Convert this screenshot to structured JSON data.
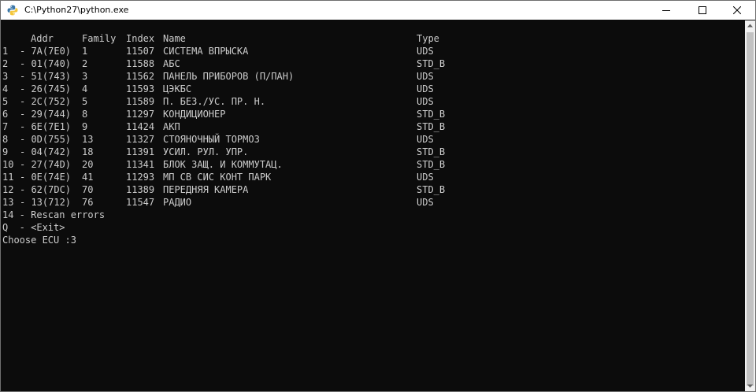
{
  "window": {
    "title": "C:\\Python27\\python.exe"
  },
  "console": {
    "header": {
      "addr": "Addr",
      "family": "Family",
      "index": "Index",
      "name": "Name",
      "type": "Type"
    },
    "rows": [
      {
        "num": "1",
        "addr": "- 7A(7E0)",
        "family": "1",
        "index": "11507",
        "name": "СИСТЕМА ВПРЫСКА",
        "type": "UDS"
      },
      {
        "num": "2",
        "addr": "- 01(740)",
        "family": "2",
        "index": "11588",
        "name": "АБС",
        "type": "STD_B"
      },
      {
        "num": "3",
        "addr": "- 51(743)",
        "family": "3",
        "index": "11562",
        "name": "ПАНЕЛЬ ПРИБОРОВ (П/ПАН)",
        "type": "UDS"
      },
      {
        "num": "4",
        "addr": "- 26(745)",
        "family": "4",
        "index": "11593",
        "name": "ЦЭКБС",
        "type": "UDS"
      },
      {
        "num": "5",
        "addr": "- 2C(752)",
        "family": "5",
        "index": "11589",
        "name": "П. БЕЗ./УС. ПР. Н.",
        "type": "UDS"
      },
      {
        "num": "6",
        "addr": "- 29(744)",
        "family": "8",
        "index": "11297",
        "name": "КОНДИЦИОНЕР",
        "type": "STD_B"
      },
      {
        "num": "7",
        "addr": "- 6E(7E1)",
        "family": "9",
        "index": "11424",
        "name": "АКП",
        "type": "STD_B"
      },
      {
        "num": "8",
        "addr": "- 0D(755)",
        "family": "13",
        "index": "11327",
        "name": "СТОЯНОЧНЫЙ ТОРМОЗ",
        "type": "UDS"
      },
      {
        "num": "9",
        "addr": "- 04(742)",
        "family": "18",
        "index": "11391",
        "name": "УСИЛ. РУЛ. УПР.",
        "type": "STD_B"
      },
      {
        "num": "10",
        "addr": "- 27(74D)",
        "family": "20",
        "index": "11341",
        "name": "БЛОК ЗАЩ. И КОММУТАЦ.",
        "type": "STD_B"
      },
      {
        "num": "11",
        "addr": "- 0E(74E)",
        "family": "41",
        "index": "11293",
        "name": "МП СВ СИС КОНТ ПАРК",
        "type": "UDS"
      },
      {
        "num": "12",
        "addr": "- 62(7DC)",
        "family": "70",
        "index": "11389",
        "name": "ПЕРЕДНЯЯ КАМЕРА",
        "type": "STD_B"
      },
      {
        "num": "13",
        "addr": "- 13(712)",
        "family": "76",
        "index": "11547",
        "name": "РАДИО",
        "type": "UDS"
      }
    ],
    "rescan": "14 - Rescan errors",
    "exit": "Q  - <Exit>",
    "prompt": "Choose ECU :3"
  },
  "colors": {
    "console_bg": "#0c0c0c",
    "console_text": "#cccccc",
    "titlebar_bg": "#ffffff",
    "scrollbar_bg": "#f0f0f0",
    "scrollbar_thumb": "#c2c2c2"
  },
  "icons": {
    "app": "python-icon",
    "minimize": "minimize-icon",
    "maximize": "maximize-icon",
    "close": "close-icon",
    "scroll_up": "arrow-up-icon",
    "scroll_down": "arrow-down-icon"
  }
}
